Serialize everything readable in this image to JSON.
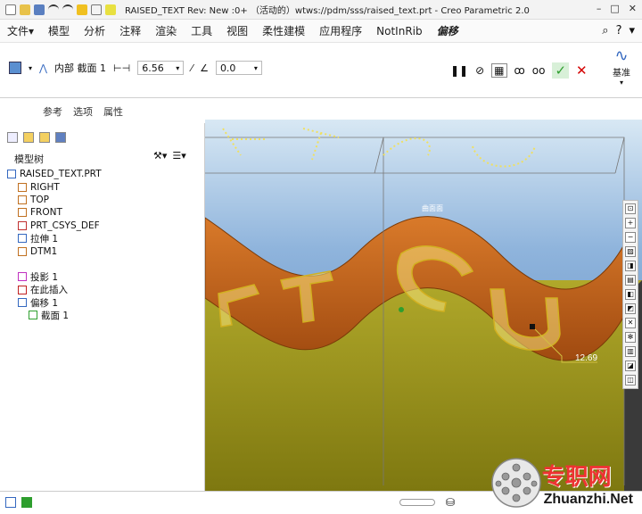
{
  "window": {
    "title": "RAISED_TEXT Rev: New :0+ （活动的）wtws://pdm/sss/raised_text.prt - Creo Parametric 2.0",
    "controls": [
      "–",
      "□",
      "✕"
    ]
  },
  "menu": {
    "items": [
      "文件▾",
      "模型",
      "分析",
      "注释",
      "渲染",
      "工具",
      "视图",
      "柔性建模",
      "应用程序",
      "NotInRib",
      "偏移"
    ],
    "active_item": "偏移"
  },
  "dashboard": {
    "section_label": "内部 截面 1",
    "depth_value": "6.56",
    "angle_value": "0.0",
    "datum_label": "基准"
  },
  "panel_tabs": [
    "参考",
    "选项",
    "属性"
  ],
  "model_tree": {
    "header": "模型树",
    "nodes": [
      {
        "label": "RAISED_TEXT.PRT",
        "icon": "part-icon",
        "indent": 0
      },
      {
        "label": "RIGHT",
        "icon": "datum-plane-icon",
        "indent": 1
      },
      {
        "label": "TOP",
        "icon": "datum-plane-icon",
        "indent": 1
      },
      {
        "label": "FRONT",
        "icon": "datum-plane-icon",
        "indent": 1
      },
      {
        "label": "PRT_CSYS_DEF",
        "icon": "csys-icon",
        "indent": 1
      },
      {
        "label": "拉伸 1",
        "icon": "extrude-icon",
        "indent": 1
      },
      {
        "label": "DTM1",
        "icon": "datum-plane-icon",
        "indent": 1
      },
      {
        "label": "",
        "icon": "",
        "indent": 1
      },
      {
        "label": "投影 1",
        "icon": "projection-icon",
        "indent": 1
      },
      {
        "label": "在此插入",
        "icon": "insert-here-icon",
        "indent": 1
      },
      {
        "label": "偏移 1",
        "icon": "offset-icon",
        "indent": 1
      },
      {
        "label": "截面 1",
        "icon": "sketch-icon",
        "indent": 2
      }
    ]
  },
  "viewport": {
    "dimension_label": "12.69",
    "surface_label": "曲面面"
  },
  "watermark": {
    "cn": "专职网",
    "en": "Zhuanzhi.Net"
  },
  "colors": {
    "accent_green": "#2e9e2e",
    "close_red": "#d40000",
    "surface_orange": "#c8661a",
    "text_yellow": "#ffff66"
  }
}
